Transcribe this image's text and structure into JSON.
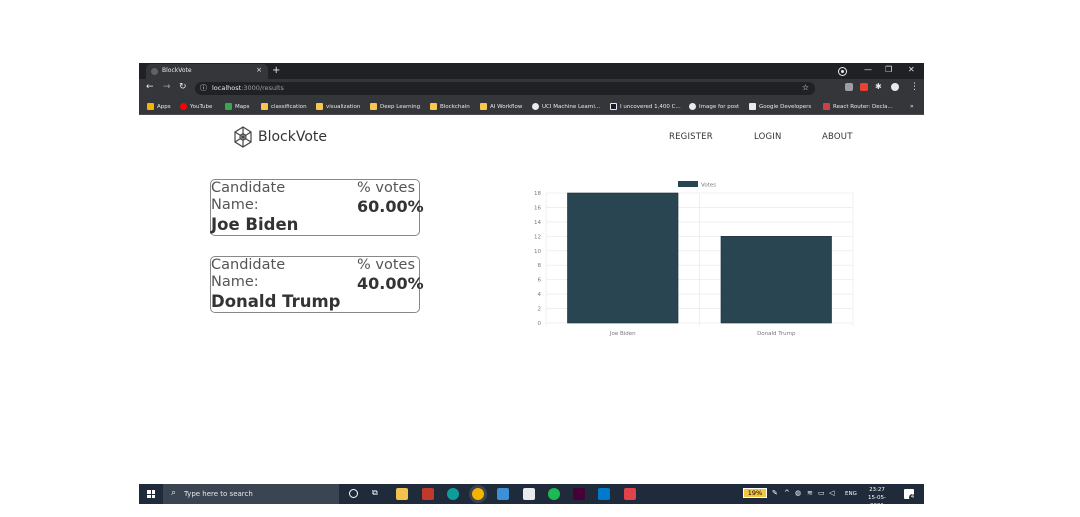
{
  "browser": {
    "tab_title": "BlockVote",
    "tab_close": "×",
    "new_tab": "+",
    "window_controls": [
      "—",
      "❐",
      "✕"
    ],
    "url_host": "localhost",
    "url_path": ":3000/results",
    "bookmarks": [
      {
        "label": "Apps",
        "color": "#f4b400"
      },
      {
        "label": "YouTube",
        "color": "#ff0000"
      },
      {
        "label": "Maps",
        "color": "#34a853"
      },
      {
        "label": "classification",
        "color": "#f9c74f"
      },
      {
        "label": "visualization",
        "color": "#f9c74f"
      },
      {
        "label": "Deep Learning",
        "color": "#f9c74f"
      },
      {
        "label": "Blockchain",
        "color": "#f9c74f"
      },
      {
        "label": "AI Workflow",
        "color": "#f9c74f"
      },
      {
        "label": "UCI Machine Learni...",
        "color": "#e8eaed"
      },
      {
        "label": "I uncovered 1,400 C...",
        "color": "#1a1a2e"
      },
      {
        "label": "Image for post",
        "color": "#e8eaed"
      },
      {
        "label": "Google Developers",
        "color": "#e8eaed"
      },
      {
        "label": "React Router: Decla...",
        "color": "#ca4245"
      }
    ],
    "bookmarks_overflow": "»"
  },
  "app": {
    "logo_text": "BlockVote",
    "nav": [
      "REGISTER",
      "LOGIN",
      "ABOUT"
    ]
  },
  "results": [
    {
      "label_line1": "Candidate",
      "label_line2": "Name:",
      "name": "Joe Biden",
      "votes_label": "% votes",
      "percent": "60.00%"
    },
    {
      "label_line1": "Candidate",
      "label_line2": "Name:",
      "name": "Donald Trump",
      "votes_label": "% votes",
      "percent": "40.00%"
    }
  ],
  "chart_data": {
    "type": "bar",
    "categories": [
      "Joe Biden",
      "Donald Trump"
    ],
    "series": [
      {
        "name": "Votes",
        "values": [
          18,
          12
        ],
        "color": "#2a4552"
      }
    ],
    "ylim": [
      0,
      18
    ],
    "yticks": [
      0,
      2,
      4,
      6,
      8,
      10,
      12,
      14,
      16,
      18
    ],
    "legend": "top-center",
    "grid": true
  },
  "taskbar": {
    "search_placeholder": "Type here to search",
    "battery": "19%",
    "language": "ENG",
    "time": "23:27",
    "date": "15-05-2021",
    "notifications": "4"
  }
}
